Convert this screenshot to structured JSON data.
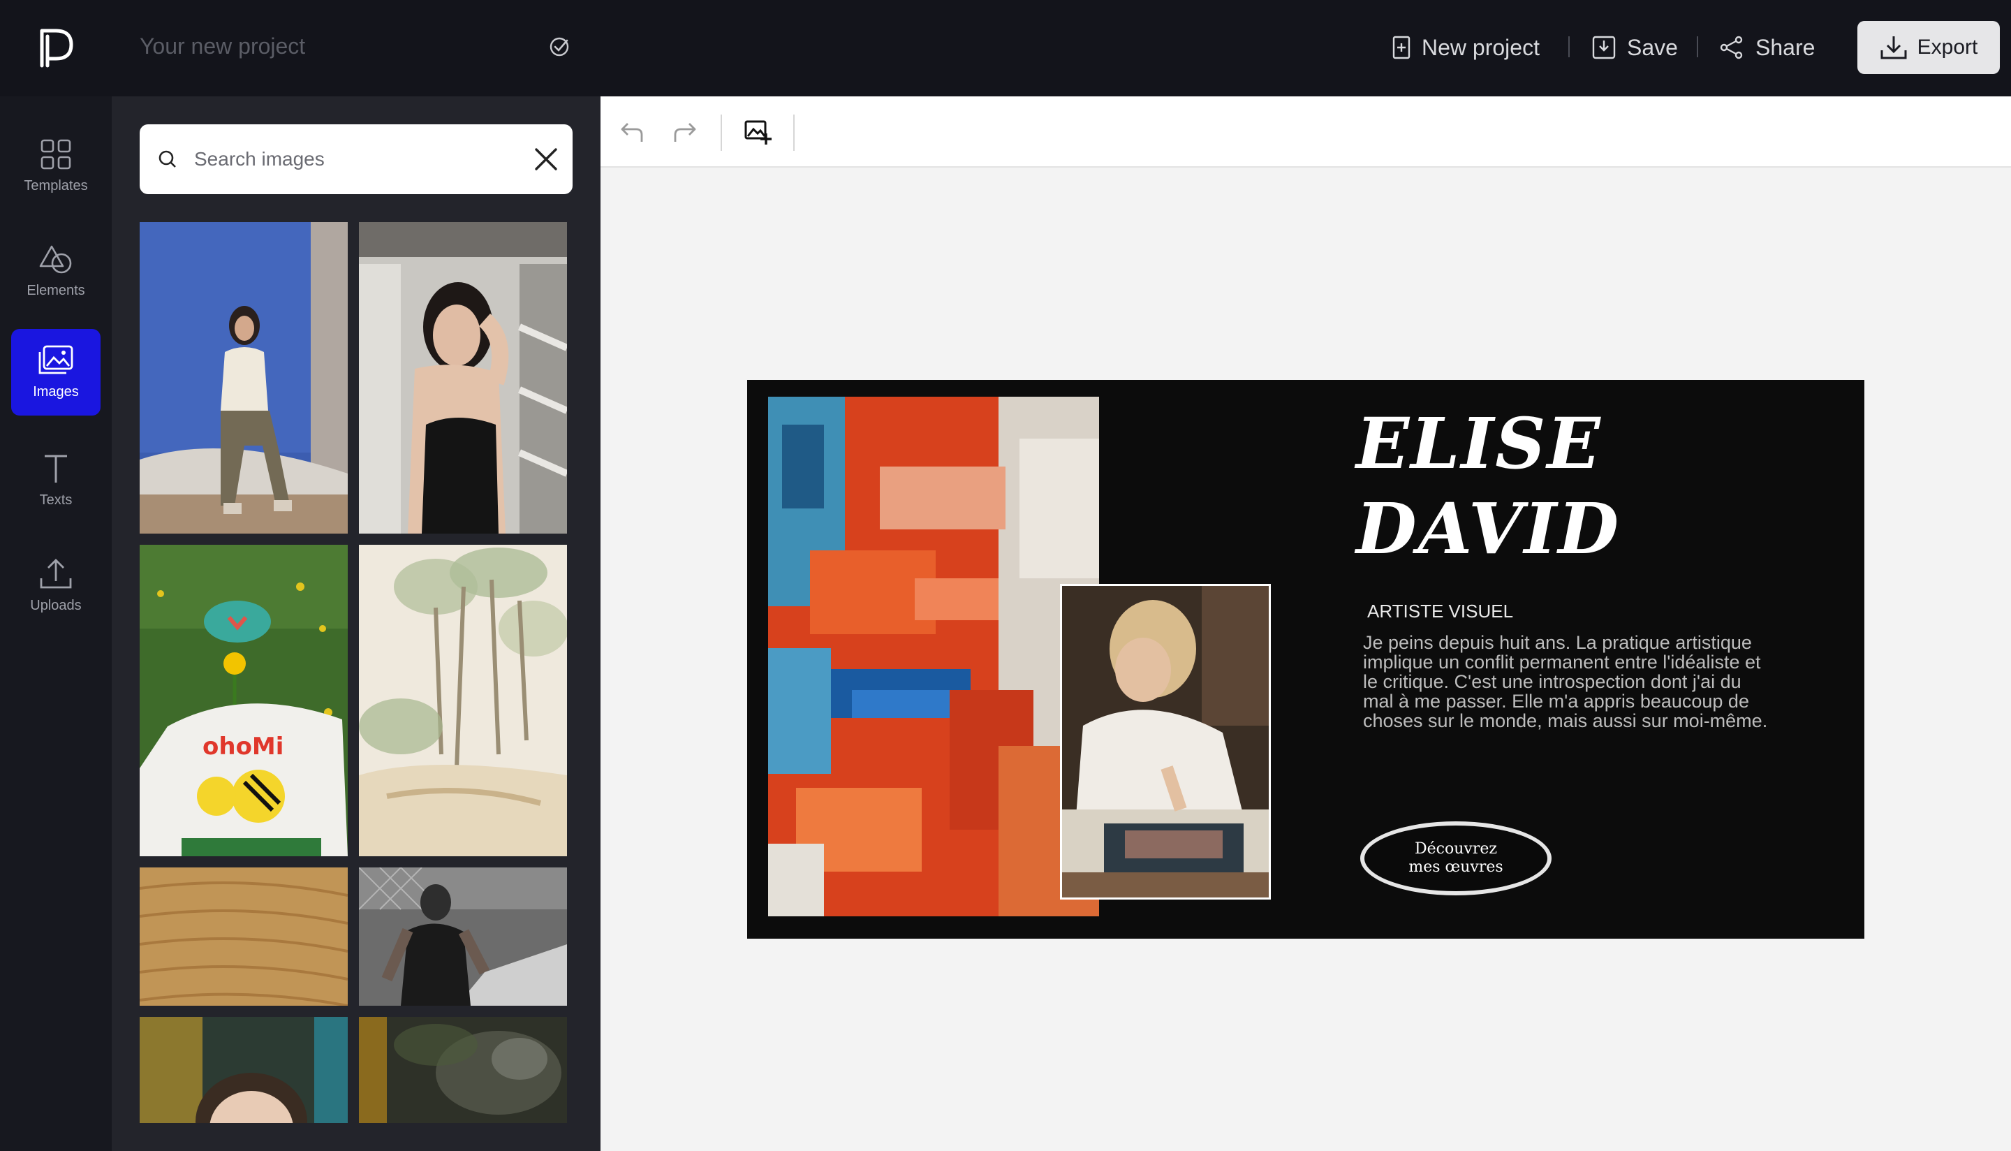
{
  "header": {
    "logo": "app-logo",
    "project_placeholder": "Your new project",
    "actions": {
      "new_project": "New project",
      "save": "Save",
      "share": "Share",
      "export": "Export"
    }
  },
  "sidebar": {
    "items": [
      {
        "label": "Templates",
        "icon": "templates-icon",
        "active": false
      },
      {
        "label": "Elements",
        "icon": "shapes-icon",
        "active": false
      },
      {
        "label": "Images",
        "icon": "images-icon",
        "active": true
      },
      {
        "label": "Texts",
        "icon": "text-icon",
        "active": false
      },
      {
        "label": "Uploads",
        "icon": "upload-icon",
        "active": false
      }
    ],
    "active_color": "#1a16e0"
  },
  "images_panel": {
    "search_placeholder": "Search images",
    "thumbnails": [
      "woman-seated-blue-backdrop",
      "woman-black-top-window",
      "person-flower-green-hat",
      "watercolor-trees",
      "sand-dunes",
      "man-chainlink-fence",
      "woman-teal-background",
      "mossy-rocks"
    ]
  },
  "toolbar": {
    "tools": [
      "undo-icon",
      "redo-icon",
      "add-image-icon"
    ]
  },
  "design": {
    "name_line1": "ELISE",
    "name_line2": "DAVID",
    "role": "ARTISTE VISUEL",
    "bio": "Je peins depuis huit ans. La pratique artistique implique un conflit permanent entre l'idéaliste et le critique. C'est une introspection dont j'ai du mal à me passer. Elle m'a appris beaucoup de choses sur le monde, mais aussi sur moi-même.",
    "cta_line1": "Découvrez",
    "cta_line2": "mes œuvres",
    "background": "#0c0c0c"
  }
}
